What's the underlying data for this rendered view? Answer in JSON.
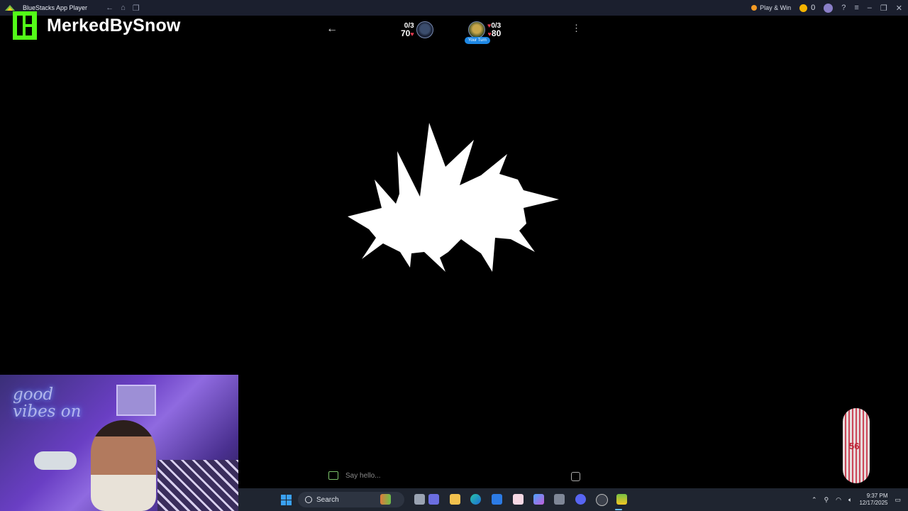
{
  "titlebar": {
    "app_title": "BlueStacks App Player",
    "play_win": "Play & Win",
    "coin_count": "0"
  },
  "overlay": {
    "streamer_name": "MerkedBySnow"
  },
  "game": {
    "player1": {
      "score": "0/3",
      "hp": "70"
    },
    "player2": {
      "score": "0/3",
      "hp": "80",
      "badge": "Your Turn"
    }
  },
  "chat": {
    "placeholder": "Say hello..."
  },
  "webcam": {
    "neon_sign": "good vibes on"
  },
  "taskbar": {
    "search_label": "Search",
    "time": "9:37 PM",
    "date": "12/17/2025"
  }
}
